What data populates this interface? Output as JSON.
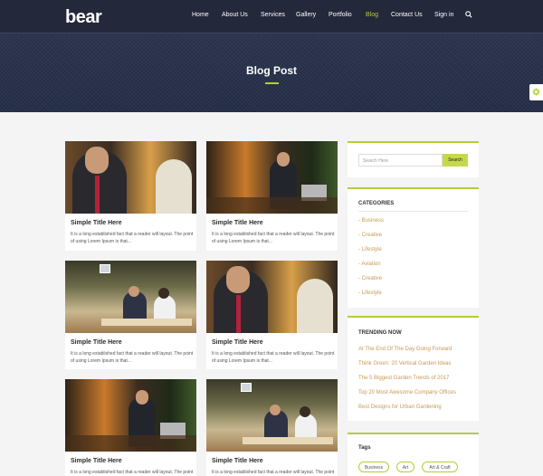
{
  "nav": {
    "logo": "bear",
    "links": [
      "Home",
      "About Us",
      "Services",
      "Gallery",
      "Portfolio",
      "Blog",
      "Contact Us",
      "Sign in"
    ],
    "active": "Blog"
  },
  "hero": {
    "title": "Blog Post"
  },
  "posts": [
    {
      "title": "Simple Title Here",
      "excerpt": "It is a long established fact that a reader will layout. The point of using Lorem Ipsum is that..."
    },
    {
      "title": "Simple Title Here",
      "excerpt": "It is a long established fact that a reader will layout. The point of using Lorem Ipsum is that..."
    },
    {
      "title": "Simple Title Here",
      "excerpt": "It is a long established fact that a reader will layout. The point of using Lorem Ipsum is that..."
    },
    {
      "title": "Simple Title Here",
      "excerpt": "It is a long established fact that a reader will layout. The point of using Lorem Ipsum is that..."
    },
    {
      "title": "Simple Title Here",
      "excerpt": "It is a long established fact that a reader will layout. The point of using Lorem Ipsum is that..."
    },
    {
      "title": "Simple Title Here",
      "excerpt": "It is a long established fact that a reader will layout. The point of using Lorem Ipsum is that..."
    }
  ],
  "sidebar": {
    "search": {
      "placeholder": "Search Here",
      "button": "Search"
    },
    "categories": {
      "heading": "CATEGORIES",
      "items": [
        "- Business",
        "- Creative",
        "- Lifestyle",
        "- Aviation",
        "- Creative",
        "- Lifestyle"
      ]
    },
    "trending": {
      "heading": "TRENDING NOW",
      "items": [
        "At The End Of The Day Going Forward",
        "Think Green: 20 Vertical Garden Ideas",
        "The 5 Biggest Garden Trends of 2017",
        "Top 20 Most Awesome Company Offices",
        "Best Designs for Urban Gardening"
      ]
    },
    "tags": {
      "heading": "Tags",
      "items": [
        "Business",
        "Art",
        "Art & Craft"
      ]
    }
  },
  "colors": {
    "nav_bg": "#23283a",
    "accent": "#b6cc3a",
    "link": "#c89a55"
  },
  "icons": [
    "search-icon",
    "gear-icon"
  ]
}
